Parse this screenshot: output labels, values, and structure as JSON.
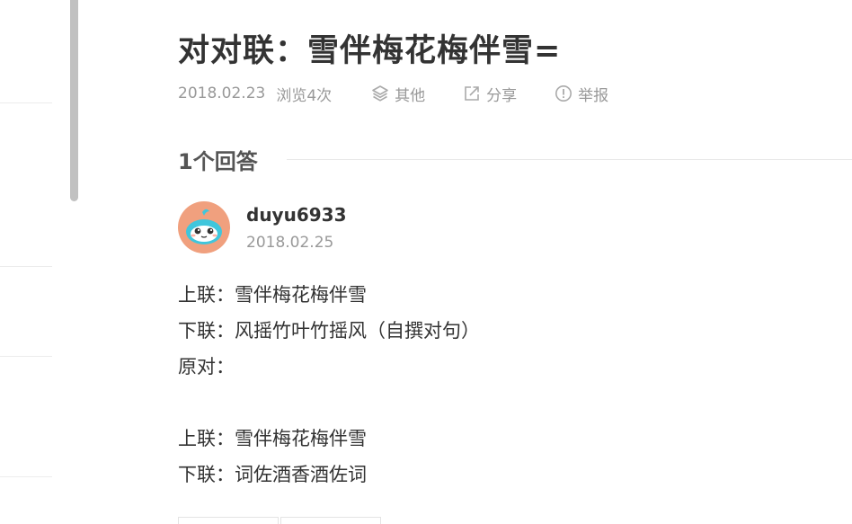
{
  "question": {
    "title": "对对联：雪伴梅花梅伴雪=",
    "date": "2018.02.23",
    "views": "浏览4次",
    "actions": [
      {
        "label": "其他",
        "icon": "layers-icon"
      },
      {
        "label": "分享",
        "icon": "share-icon"
      },
      {
        "label": "举报",
        "icon": "report-icon"
      }
    ]
  },
  "answers": {
    "count_label": "1个回答",
    "items": [
      {
        "username": "duyu6933",
        "date": "2018.02.25",
        "avatar_icon": "cartoon-avatar",
        "lines": [
          "上联：雪伴梅花梅伴雪",
          "下联：风摇竹叶竹摇风（自撰对句）",
          "原对：",
          "",
          "上联：雪伴梅花梅伴雪",
          "下联：词佐酒香酒佐词"
        ]
      }
    ]
  },
  "colors": {
    "title": "#333333",
    "meta": "#999999",
    "avatar_bg": "#f0a07e",
    "avatar_face": "#3fc6dc"
  }
}
